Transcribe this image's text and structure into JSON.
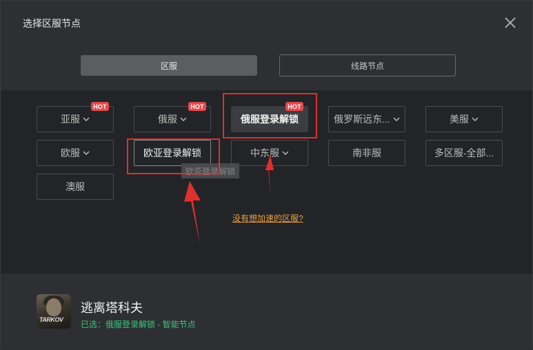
{
  "dialog": {
    "title": "选择区服节点",
    "close_icon": "close-icon"
  },
  "tabs": [
    {
      "label": "区服",
      "active": true
    },
    {
      "label": "线路节点",
      "active": false
    }
  ],
  "regions": [
    {
      "label": "亚服",
      "dropdown": true,
      "hot": true
    },
    {
      "label": "俄服",
      "dropdown": true,
      "hot": true
    },
    {
      "label": "俄服登录解锁",
      "dropdown": false,
      "hot": true,
      "selected": true
    },
    {
      "label": "俄罗斯远东...",
      "dropdown": true,
      "hot": false
    },
    {
      "label": "美服",
      "dropdown": true,
      "hot": false
    },
    {
      "label": "欧服",
      "dropdown": true,
      "hot": false
    },
    {
      "label": "欧亚登录解锁",
      "dropdown": false,
      "hot": false
    },
    {
      "label": "中东服",
      "dropdown": true,
      "hot": false
    },
    {
      "label": "南非服",
      "dropdown": false,
      "hot": false
    },
    {
      "label": "多区服-全部...",
      "dropdown": false,
      "hot": false
    },
    {
      "label": "澳服",
      "dropdown": false,
      "hot": false
    }
  ],
  "hot_badge": "HOT",
  "tooltip": "欧亚登录解锁",
  "missing_region_link": "没有想加速的区服?",
  "footer": {
    "game_name": "逃离塔科夫",
    "game_icon_text": "TARKOV",
    "status": "已选：俄服登录解锁 - 智能节点"
  },
  "colors": {
    "hot_badge": "#e8484c",
    "annotation_red": "#e0302e",
    "link": "#e8a040",
    "status_green": "#3cc47c"
  }
}
